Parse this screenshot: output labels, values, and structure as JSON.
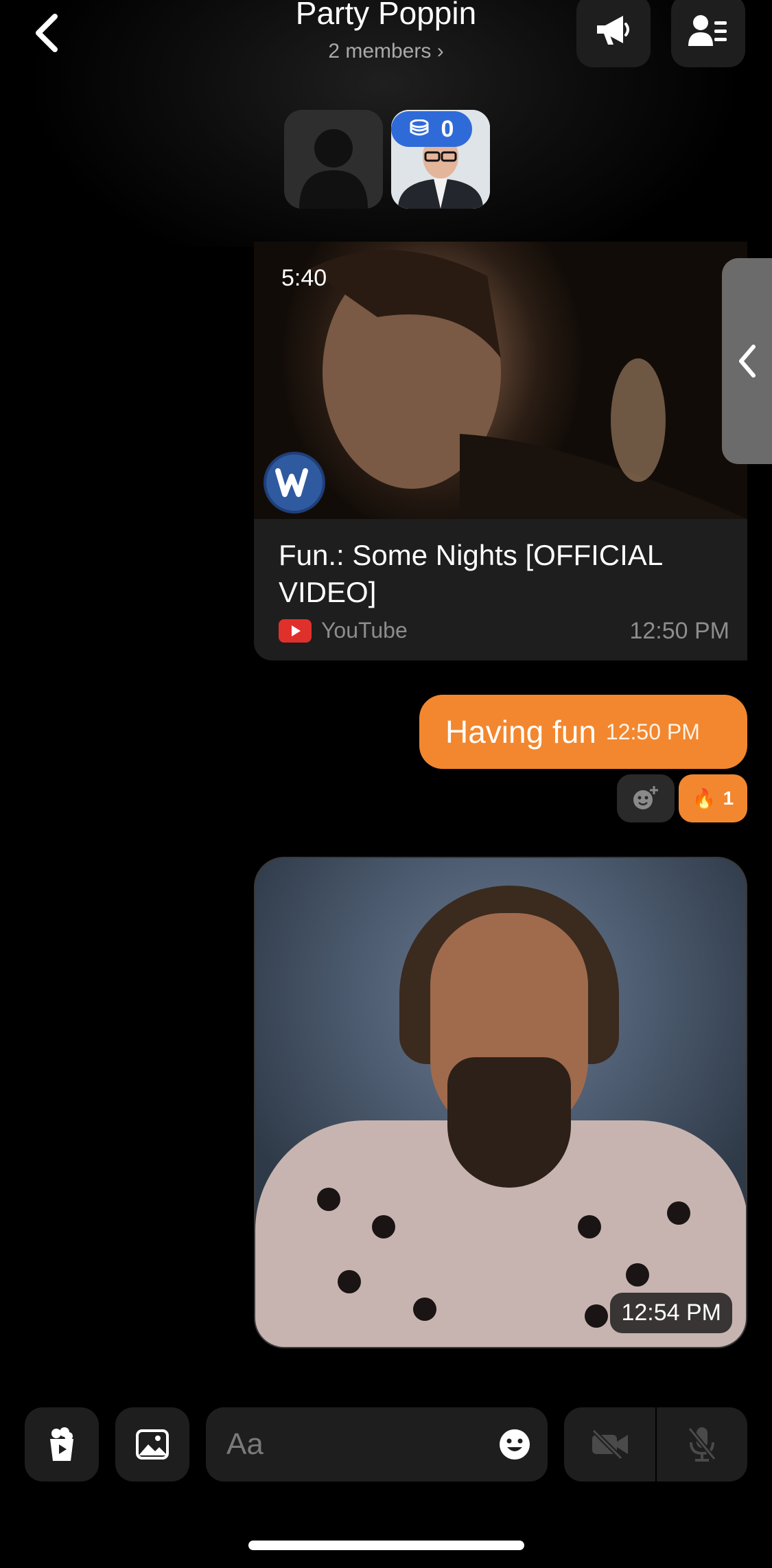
{
  "header": {
    "title": "Party Poppin",
    "members_link": "2 members ›"
  },
  "avatars": {
    "coin_count": "0"
  },
  "video_message": {
    "duration": "5:40",
    "title": "Fun.: Some Nights [OFFICIAL VIDEO]",
    "source": "YouTube",
    "time": "12:50 PM"
  },
  "text_message": {
    "text": "Having fun",
    "time": "12:50 PM",
    "reaction_emoji": "🔥",
    "reaction_count": "1"
  },
  "photo_message": {
    "time": "12:54 PM"
  },
  "composer": {
    "placeholder": "Aa"
  },
  "colors": {
    "accent": "#f2872f",
    "background": "#000000",
    "surface": "#1e1e1e",
    "coin_badge": "#2f6bd8"
  }
}
